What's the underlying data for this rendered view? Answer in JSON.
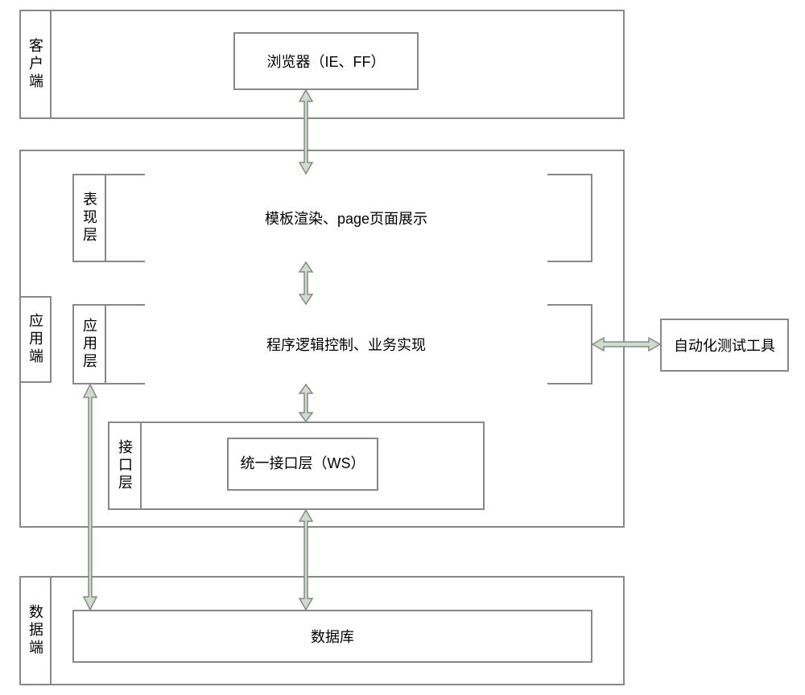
{
  "tiers": {
    "client": {
      "label": "客户端",
      "browser_box": "浏览器（IE、FF）"
    },
    "application": {
      "label": "应用端",
      "presentation": {
        "label": "表现层",
        "text": "模板渲染、page页面展示"
      },
      "application_layer": {
        "label": "应用层",
        "text": "程序逻辑控制、业务实现"
      },
      "interface": {
        "label": "接口层",
        "text": "统一接口层（WS）"
      }
    },
    "data": {
      "label": "数据端",
      "db": "数据库"
    }
  },
  "side_tool": "自动化测试工具"
}
